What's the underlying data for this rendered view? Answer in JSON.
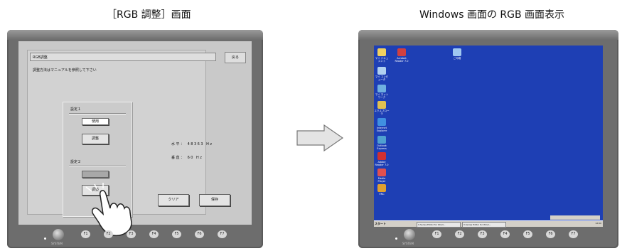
{
  "captions": {
    "left": "［RGB 調整］画面",
    "right": "Windows 画面の RGB 画面表示"
  },
  "device": {
    "system_label": "SYSTEM",
    "function_keys": [
      "F1",
      "F2",
      "F3",
      "F4",
      "F5",
      "F6",
      "F7"
    ]
  },
  "rgb_screen": {
    "title": "RGB調整",
    "back_label": "戻る",
    "instruction": "調整方法はマニュアルを参照して下さい",
    "setting1": {
      "label": "設定１",
      "use_label": "使用",
      "adjust_label": "調整"
    },
    "setting2": {
      "label": "設定２",
      "use_label": "",
      "adjust_label": "調整"
    },
    "horizontal": "水平： 48363 Hz",
    "vertical": "垂直： 60   Hz",
    "clear_label": "クリア",
    "save_label": "保存"
  },
  "desktop": {
    "icons": [
      {
        "label": "マイ ドキュメント",
        "color": "#f0d060"
      },
      {
        "label": "Acrobat Reader 7.0",
        "color": "#d04040"
      },
      {
        "label": "ごみ箱",
        "color": "#a0c8f0"
      },
      {
        "label": "マイ コンピュータ",
        "color": "#b0d0f0"
      },
      {
        "label": "マイ ネットワーク",
        "color": "#70b0e0"
      },
      {
        "label": "エクスプローラ",
        "color": "#e0c050"
      },
      {
        "label": "Internet Explorer",
        "color": "#4090e0"
      },
      {
        "label": "Outlook Express",
        "color": "#50a0d0"
      },
      {
        "label": "Adobe Reader 7.0",
        "color": "#d03030"
      },
      {
        "label": "Media Player",
        "color": "#e05050"
      },
      {
        "label": "VNC",
        "color": "#e0a030"
      }
    ],
    "taskbar": {
      "start": "スタート",
      "items": [
        "V-Series Editor for Wind...",
        "V-Series Editor for Wind..."
      ],
      "tray": "12:00"
    }
  }
}
